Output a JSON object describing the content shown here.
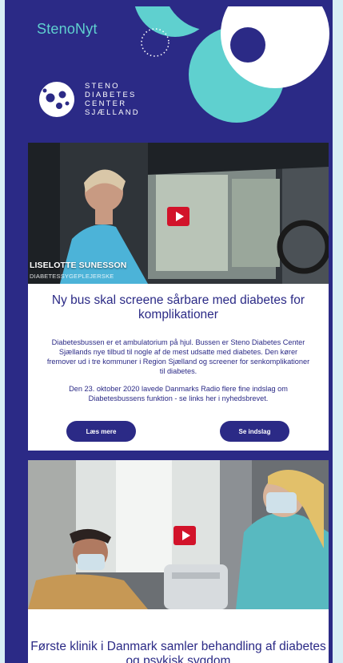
{
  "header": {
    "brand": "StenoNyt",
    "logo_lines": [
      "STENO",
      "DIABETES",
      "CENTER",
      "SJÆLLAND"
    ]
  },
  "colors": {
    "navy": "#2b2a86",
    "teal": "#5fd0cf",
    "play_red": "#d2132a",
    "outer_bg": "#d9eef5"
  },
  "articles": [
    {
      "video": {
        "caption_name": "LISELOTTE SUNESSON",
        "caption_role": "DIABETESSYGEPLEJERSKE",
        "play_icon": "play-icon"
      },
      "headline": "Ny bus skal screene sårbare med diabetes for komplikationer",
      "paragraphs": [
        "Diabetesbussen er et ambulatorium på hjul. Bussen er Steno Diabetes Center Sjællands nye tilbud til nogle af de mest udsatte med diabetes. Den kører fremover ud i tre kommuner i Region Sjælland og screener for senkomplikationer til diabetes.",
        "Den 23. oktober 2020 lavede Danmarks Radio flere fine indslag om Diabetesbussens funktion - se links her i nyhedsbrevet."
      ],
      "buttons": {
        "read_more": "Læs mere",
        "see_clip": "Se indslag"
      }
    },
    {
      "video": {
        "play_icon": "play-icon"
      },
      "headline": "Første klinik i Danmark samler behandling af diabetes og psykisk sygdom"
    }
  ]
}
